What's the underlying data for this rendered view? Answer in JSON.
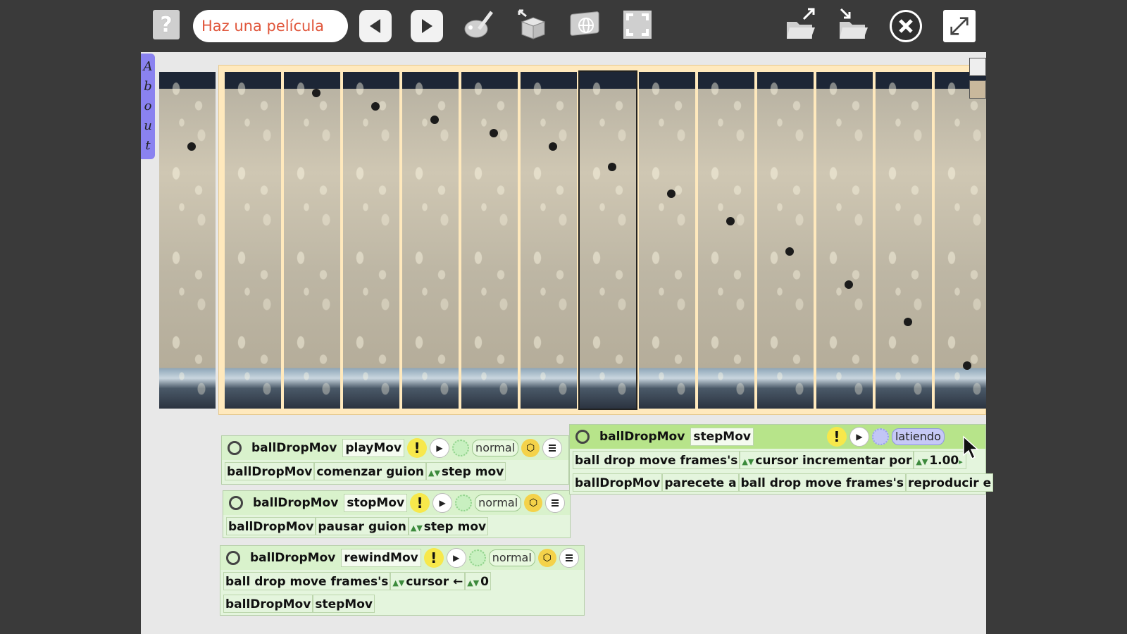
{
  "toolbar": {
    "help_label": "?",
    "project_name": "Haz una película",
    "icons": [
      "help-icon",
      "back-icon",
      "forward-icon",
      "paint-icon",
      "supplies-icon",
      "globe-icon",
      "fullscreen-frame-icon",
      "load-icon",
      "save-icon",
      "close-icon",
      "expand-icon"
    ]
  },
  "about_tab": {
    "letters": [
      "A",
      "b",
      "o",
      "u",
      "t"
    ]
  },
  "filmstrip": {
    "selected_frame": 7,
    "ball_positions": [
      0.21,
      null,
      0.05,
      0.09,
      0.13,
      0.17,
      0.21,
      0.27,
      0.35,
      0.43,
      0.52,
      0.62,
      0.73,
      0.86
    ]
  },
  "scripts": {
    "play": {
      "object": "ballDropMov",
      "name": "playMov",
      "bang": "!",
      "status": "normal",
      "row1": {
        "a": "ballDropMov",
        "b": "comenzar guion",
        "c": "step mov"
      }
    },
    "stop": {
      "object": "ballDropMov",
      "name": "stopMov",
      "bang": "!",
      "status": "normal",
      "row1": {
        "a": "ballDropMov",
        "b": "pausar guion",
        "c": "step mov"
      }
    },
    "rewind": {
      "object": "ballDropMov",
      "name": "rewindMov",
      "bang": "!",
      "status": "normal",
      "row1": {
        "a": "ball drop move frames's",
        "b": "cursor",
        "arrow": "←",
        "c": "0"
      },
      "row2": {
        "a": "ballDropMov",
        "b": "stepMov"
      }
    },
    "step": {
      "object": "ballDropMov",
      "name": "stepMov",
      "bang": "!",
      "status": "latiendo",
      "row1": {
        "a": "ball drop move frames's",
        "b": "cursor incrementar por",
        "c": "1.00"
      },
      "row2": {
        "a": "ballDropMov",
        "b": "parecete a",
        "c": "ball drop move frames's",
        "d": "reproducir e"
      }
    }
  }
}
